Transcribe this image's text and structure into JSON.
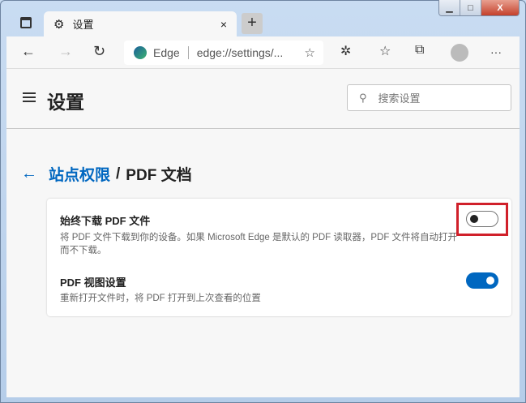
{
  "window": {
    "minimize": "▁",
    "maximize": "□",
    "close": "X"
  },
  "tab": {
    "title": "设置",
    "close": "×",
    "new_tab": "+"
  },
  "toolbar": {
    "back": "←",
    "forward": "→",
    "refresh": "↻",
    "site_label": "Edge",
    "url": "edge://settings/...",
    "more": "···"
  },
  "header": {
    "title": "设置",
    "search_placeholder": "搜索设置"
  },
  "breadcrumb": {
    "back": "←",
    "parent": "站点权限",
    "separator": "/",
    "current": "PDF 文档"
  },
  "settings": [
    {
      "title": "始终下载 PDF 文件",
      "description": "将 PDF 文件下载到你的设备。如果 Microsoft Edge 是默认的 PDF 读取器，PDF 文件将自动打开而不下载。",
      "enabled": false
    },
    {
      "title": "PDF 视图设置",
      "description": "重新打开文件时，将 PDF 打开到上次查看的位置",
      "enabled": true
    }
  ],
  "colors": {
    "accent": "#0067c0",
    "highlight": "#d0202a"
  }
}
